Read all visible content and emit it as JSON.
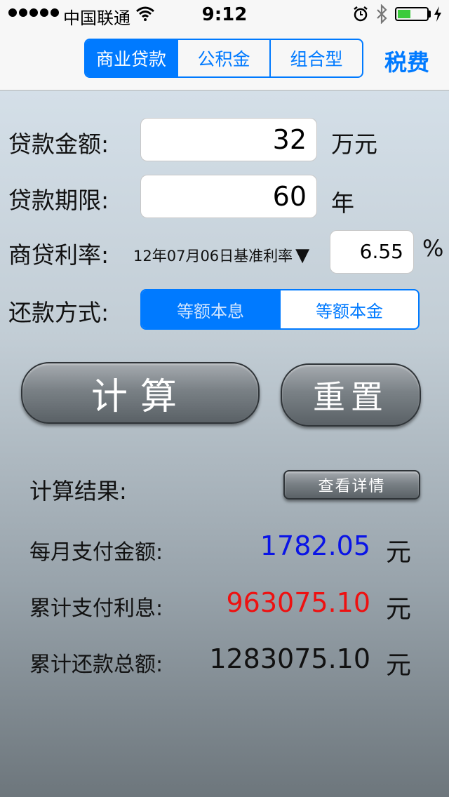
{
  "status_bar": {
    "carrier": "中国联通",
    "time": "9:12",
    "battery_level": 0.45,
    "battery_color": "#3ccb3c"
  },
  "nav": {
    "tabs": [
      {
        "label": "商业贷款",
        "active": true
      },
      {
        "label": "公积金",
        "active": false
      },
      {
        "label": "组合型",
        "active": false
      }
    ],
    "tax_label": "税费",
    "accent": "#007aff"
  },
  "form": {
    "amount_label": "贷款金额:",
    "amount_value": "32",
    "amount_unit": "万元",
    "term_label": "贷款期限:",
    "term_value": "60",
    "term_unit": "年",
    "rate_label": "商贷利率:",
    "rate_option": "12年07月06日基准利率",
    "rate_value": "6.55",
    "rate_unit": "%",
    "method_label": "还款方式:",
    "methods": [
      {
        "label": "等额本息",
        "active": true
      },
      {
        "label": "等额本金",
        "active": false
      }
    ]
  },
  "buttons": {
    "calculate": "计算",
    "reset": "重置",
    "detail": "查看详情"
  },
  "results": {
    "title": "计算结果:",
    "monthly_label": "每月支付金额:",
    "monthly_value": "1782.05",
    "monthly_color": "#0a14e6",
    "interest_label": "累计支付利息:",
    "interest_value": "963075.10",
    "interest_color": "#ee1111",
    "total_label": "累计还款总额:",
    "total_value": "1283075.10",
    "total_color": "#111111",
    "unit": "元"
  }
}
